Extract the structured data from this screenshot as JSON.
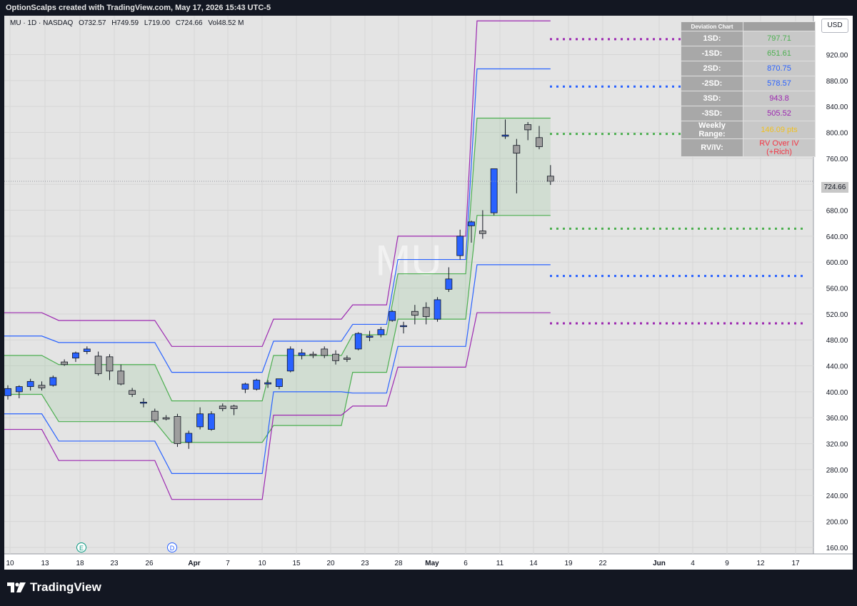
{
  "header": {
    "title": "OptionScalps created with TradingView.com, May 17, 2026 15:43 UTC-5"
  },
  "symbol_bar": {
    "symbol": "MU · 1D · NASDAQ",
    "open": "O732.57",
    "high": "H749.59",
    "low": "L719.00",
    "close": "C724.66",
    "volume": "Vol48.52 M"
  },
  "currency": "USD",
  "last_price_label": "724.66",
  "watermark": "MU",
  "footer": {
    "brand": "TradingView"
  },
  "event_markers": [
    {
      "label": "E",
      "color": "#089981"
    },
    {
      "label": "D",
      "color": "#2962ff"
    }
  ],
  "deviation_table": {
    "header": "Deviation Chart",
    "rows": [
      {
        "label": "1SD:",
        "value": "797.71",
        "color": "#4caf50"
      },
      {
        "label": "-1SD:",
        "value": "651.61",
        "color": "#4caf50"
      },
      {
        "label": "2SD:",
        "value": "870.75",
        "color": "#2962ff"
      },
      {
        "label": "-2SD:",
        "value": "578.57",
        "color": "#2962ff"
      },
      {
        "label": "3SD:",
        "value": "943.8",
        "color": "#9c27b0"
      },
      {
        "label": "-3SD:",
        "value": "505.52",
        "color": "#9c27b0"
      },
      {
        "label": "Weekly Range:",
        "value": "146.09 pts",
        "color": "#f0c020"
      },
      {
        "label": "RV/IV:",
        "value": "RV Over IV (+Rich)",
        "color": "#f23645"
      }
    ]
  },
  "chart_data": {
    "type": "candlestick",
    "symbol": "MU",
    "ylim": [
      150,
      980
    ],
    "y_ticks": [
      160,
      200,
      240,
      280,
      320,
      360,
      400,
      440,
      480,
      520,
      560,
      600,
      640,
      680,
      720,
      760,
      800,
      840,
      880,
      920
    ],
    "x_tick_labels": [
      "10",
      "13",
      "18",
      "23",
      "26",
      "Apr",
      "7",
      "10",
      "15",
      "20",
      "23",
      "28",
      "May",
      "6",
      "11",
      "14",
      "19",
      "22",
      "Jun",
      "4",
      "9",
      "12",
      "17"
    ],
    "colors": {
      "up": "#2962ff",
      "down": "#9e9e9e",
      "band1": "#4caf50",
      "band2": "#2962ff",
      "band3": "#9c27b0"
    },
    "candles": [
      {
        "o": 394,
        "h": 410,
        "l": 388,
        "c": 405
      },
      {
        "o": 400,
        "h": 410,
        "l": 390,
        "c": 408
      },
      {
        "o": 408,
        "h": 420,
        "l": 402,
        "c": 416
      },
      {
        "o": 410,
        "h": 416,
        "l": 402,
        "c": 406
      },
      {
        "o": 410,
        "h": 425,
        "l": 408,
        "c": 422
      },
      {
        "o": 446,
        "h": 450,
        "l": 440,
        "c": 442
      },
      {
        "o": 452,
        "h": 462,
        "l": 446,
        "c": 460
      },
      {
        "o": 462,
        "h": 470,
        "l": 458,
        "c": 466
      },
      {
        "o": 455,
        "h": 462,
        "l": 425,
        "c": 428
      },
      {
        "o": 454,
        "h": 458,
        "l": 418,
        "c": 432
      },
      {
        "o": 432,
        "h": 442,
        "l": 410,
        "c": 412
      },
      {
        "o": 402,
        "h": 406,
        "l": 392,
        "c": 396
      },
      {
        "o": 384,
        "h": 390,
        "l": 376,
        "c": 384
      },
      {
        "o": 370,
        "h": 374,
        "l": 352,
        "c": 356
      },
      {
        "o": 360,
        "h": 364,
        "l": 356,
        "c": 358
      },
      {
        "o": 362,
        "h": 366,
        "l": 315,
        "c": 320
      },
      {
        "o": 322,
        "h": 340,
        "l": 312,
        "c": 336
      },
      {
        "o": 346,
        "h": 376,
        "l": 342,
        "c": 366
      },
      {
        "o": 342,
        "h": 370,
        "l": 340,
        "c": 366
      },
      {
        "o": 378,
        "h": 382,
        "l": 370,
        "c": 374
      },
      {
        "o": 378,
        "h": 380,
        "l": 364,
        "c": 374
      },
      {
        "o": 404,
        "h": 414,
        "l": 398,
        "c": 412
      },
      {
        "o": 404,
        "h": 420,
        "l": 402,
        "c": 418
      },
      {
        "o": 412,
        "h": 418,
        "l": 406,
        "c": 414
      },
      {
        "o": 408,
        "h": 418,
        "l": 404,
        "c": 420
      },
      {
        "o": 432,
        "h": 470,
        "l": 430,
        "c": 466
      },
      {
        "o": 456,
        "h": 466,
        "l": 450,
        "c": 460
      },
      {
        "o": 458,
        "h": 462,
        "l": 452,
        "c": 456
      },
      {
        "o": 466,
        "h": 470,
        "l": 452,
        "c": 456
      },
      {
        "o": 458,
        "h": 464,
        "l": 442,
        "c": 448
      },
      {
        "o": 452,
        "h": 456,
        "l": 446,
        "c": 450
      },
      {
        "o": 466,
        "h": 492,
        "l": 464,
        "c": 490
      },
      {
        "o": 484,
        "h": 494,
        "l": 478,
        "c": 486
      },
      {
        "o": 488,
        "h": 500,
        "l": 484,
        "c": 496
      },
      {
        "o": 510,
        "h": 526,
        "l": 508,
        "c": 524
      },
      {
        "o": 502,
        "h": 508,
        "l": 490,
        "c": 502
      },
      {
        "o": 524,
        "h": 534,
        "l": 504,
        "c": 518
      },
      {
        "o": 530,
        "h": 538,
        "l": 504,
        "c": 516
      },
      {
        "o": 512,
        "h": 546,
        "l": 508,
        "c": 542
      },
      {
        "o": 558,
        "h": 592,
        "l": 554,
        "c": 574
      },
      {
        "o": 610,
        "h": 650,
        "l": 604,
        "c": 640
      },
      {
        "o": 656,
        "h": 664,
        "l": 630,
        "c": 662
      },
      {
        "o": 648,
        "h": 680,
        "l": 636,
        "c": 644
      },
      {
        "o": 676,
        "h": 744,
        "l": 672,
        "c": 744
      },
      {
        "o": 794,
        "h": 820,
        "l": 790,
        "c": 796
      },
      {
        "o": 780,
        "h": 790,
        "l": 706,
        "c": 768
      },
      {
        "o": 812,
        "h": 816,
        "l": 788,
        "c": 804
      },
      {
        "o": 792,
        "h": 810,
        "l": 774,
        "c": 778
      },
      {
        "o": 732.57,
        "h": 749.59,
        "l": 719,
        "c": 724.66
      }
    ],
    "bands_weekly": {
      "levels": [
        {
          "m1": 396,
          "p1": 456,
          "m2": 366,
          "p2": 486,
          "m3": 342,
          "p3": 522
        },
        {
          "m1": 354,
          "p1": 442,
          "m2": 324,
          "p2": 476,
          "m3": 294,
          "p3": 510
        },
        {
          "m1": 322,
          "p1": 386,
          "m2": 274,
          "p2": 430,
          "m3": 234,
          "p3": 470
        },
        {
          "m1": 348,
          "p1": 456,
          "m2": 400,
          "p2": 478,
          "m3": 364,
          "p3": 512
        },
        {
          "m1": 430,
          "p1": 488,
          "m2": 398,
          "p2": 504,
          "m3": 378,
          "p3": 534
        },
        {
          "m1": 512,
          "p1": 582,
          "m2": 470,
          "p2": 604,
          "m3": 438,
          "p3": 640
        },
        {
          "m1": 672,
          "p1": 822,
          "m2": 596,
          "p2": 898,
          "m3": 522,
          "p3": 972
        }
      ]
    },
    "deviation_levels": [
      {
        "name": "1SD",
        "value": 797.71,
        "color": "#4caf50"
      },
      {
        "name": "-1SD",
        "value": 651.61,
        "color": "#4caf50"
      },
      {
        "name": "2SD",
        "value": 870.75,
        "color": "#2962ff"
      },
      {
        "name": "-2SD",
        "value": 578.57,
        "color": "#2962ff"
      },
      {
        "name": "3SD",
        "value": 943.8,
        "color": "#9c27b0"
      },
      {
        "name": "-3SD",
        "value": 505.52,
        "color": "#9c27b0"
      }
    ]
  }
}
